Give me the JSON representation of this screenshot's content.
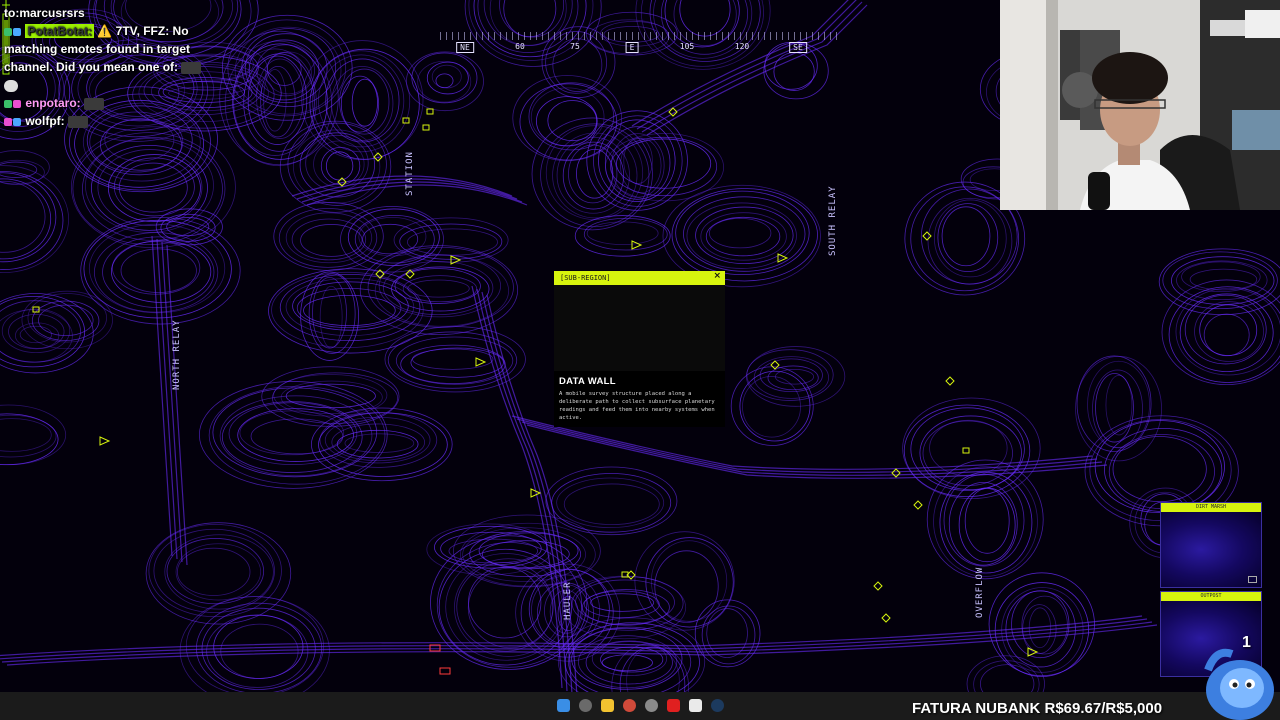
{
  "chat": {
    "lines": [
      {
        "user": "to:marcusrsrs",
        "text": ""
      },
      {
        "user": "PotatBotat:",
        "prefix": "⚠️",
        "text": "7TV, FFZ: No"
      },
      {
        "user": "",
        "text": "matching emotes found in target"
      },
      {
        "user": "",
        "text": "channel. Did you mean one of:"
      },
      {
        "user": "",
        "text": ""
      },
      {
        "user": "enpotaro:",
        "text": ""
      },
      {
        "user": "wolfpf:",
        "text": ""
      }
    ]
  },
  "compass": {
    "labels": [
      "NE",
      "60",
      "75",
      "E",
      "105",
      "120",
      "SE"
    ]
  },
  "map": {
    "labels": [
      "STATION",
      "SOUTH RELAY",
      "NORTH RELAY",
      "HAULER",
      "OVERFLOW"
    ],
    "accent": "#d7f40e",
    "contour_color": "#6a2cff"
  },
  "popup": {
    "header": "[SUB-REGION]",
    "close": "×",
    "title": "DATA WALL",
    "description": "A mobile survey structure placed along a deliberate path to collect subsurface planetary readings and feed them into nearby systems when active."
  },
  "minimaps": [
    {
      "title": "DIRT MARSH"
    },
    {
      "title": "OUTPOST"
    }
  ],
  "overlay": {
    "fatura": "FATURA NUBANK R$69.67/R$5,000",
    "badge_count": "1"
  },
  "taskbar": {
    "icons": [
      "windows-icon",
      "search-icon",
      "folder-icon",
      "chrome-icon",
      "browser-icon",
      "youtube-icon",
      "notion-icon",
      "steam-icon"
    ]
  }
}
